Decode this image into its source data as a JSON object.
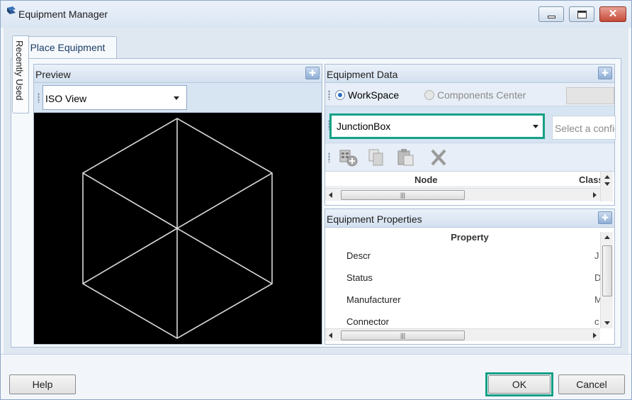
{
  "window": {
    "title": "Equipment Manager",
    "controls": {
      "minimize": "minimize-icon",
      "maximize": "maximize-icon",
      "close": "close-icon",
      "close_glyph": "✕"
    }
  },
  "tabs": {
    "active": "Place Equipment",
    "side": "Recently Used"
  },
  "preview": {
    "title": "Preview",
    "view_select": {
      "value": "ISO View"
    },
    "render": {
      "background": "#000000",
      "line_color": "#d8d8d8",
      "shape": "cube"
    }
  },
  "equipment_data": {
    "title": "Equipment Data",
    "source_options": [
      {
        "label": "WorkSpace",
        "selected": true,
        "enabled": true
      },
      {
        "label": "Components Center",
        "selected": false,
        "enabled": false
      }
    ],
    "equipment_combo": {
      "value": "JunctionBox"
    },
    "config_placeholder": "Select a configuration",
    "toolbar_icons": [
      "add-equipment-icon",
      "copy-icon",
      "paste-icon",
      "delete-icon"
    ],
    "columns": [
      "Node",
      "Class"
    ]
  },
  "equipment_properties": {
    "title": "Equipment Properties",
    "column": "Property",
    "rows": [
      {
        "name": "Descr",
        "value": "J"
      },
      {
        "name": "Status",
        "value": "D"
      },
      {
        "name": "Manufacturer",
        "value": "M"
      },
      {
        "name": "Connector",
        "value": "c"
      }
    ]
  },
  "footer": {
    "help": "Help",
    "ok": "OK",
    "cancel": "Cancel"
  },
  "colors": {
    "highlight": "#14a085",
    "panel_header": "#d3e0ef",
    "accent": "#2a6fc2"
  }
}
